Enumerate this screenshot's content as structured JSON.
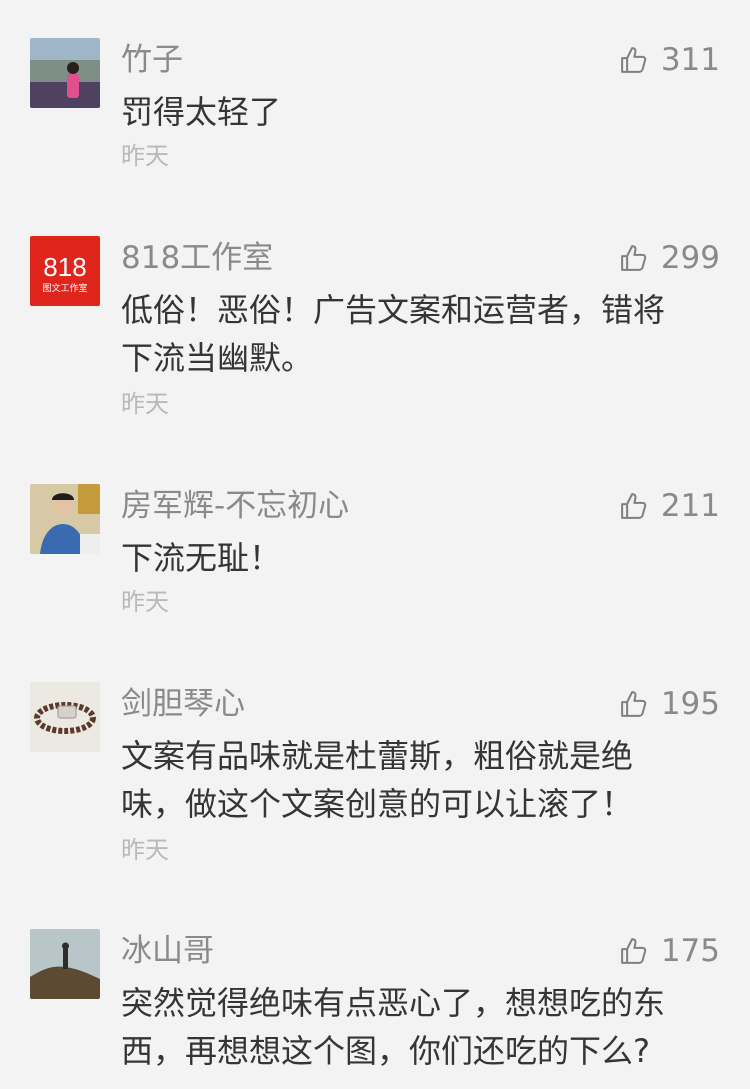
{
  "comments": [
    {
      "avatar": "woman-scenery-photo",
      "name": "竹子",
      "likes": "311",
      "text": "罚得太轻了",
      "time": "昨天"
    },
    {
      "avatar": "818-studio-logo",
      "avatar_logo": {
        "main": "818",
        "sub": "图文工作室",
        "color": "#e0251c"
      },
      "name": "818工作室",
      "likes": "299",
      "text": "低俗！恶俗！广告文案和运营者，错将\n下流当幽默。",
      "time": "昨天"
    },
    {
      "avatar": "man-photo",
      "name": "房军辉-不忘初心",
      "likes": "211",
      "text": "下流无耻！",
      "time": "昨天"
    },
    {
      "avatar": "bracelet-photo",
      "name": "剑胆琴心",
      "likes": "195",
      "text": "文案有品味就是杜蕾斯，粗俗就是绝\n味，做这个文案创意的可以让滚了！",
      "time": "昨天"
    },
    {
      "avatar": "mountain-photo",
      "name": "冰山哥",
      "likes": "175",
      "text": "突然觉得绝味有点恶心了，想想吃的东\n西，再想想这个图，你们还吃的下么?",
      "time": ""
    }
  ],
  "icons": {
    "like": "thumbs-up-icon"
  }
}
